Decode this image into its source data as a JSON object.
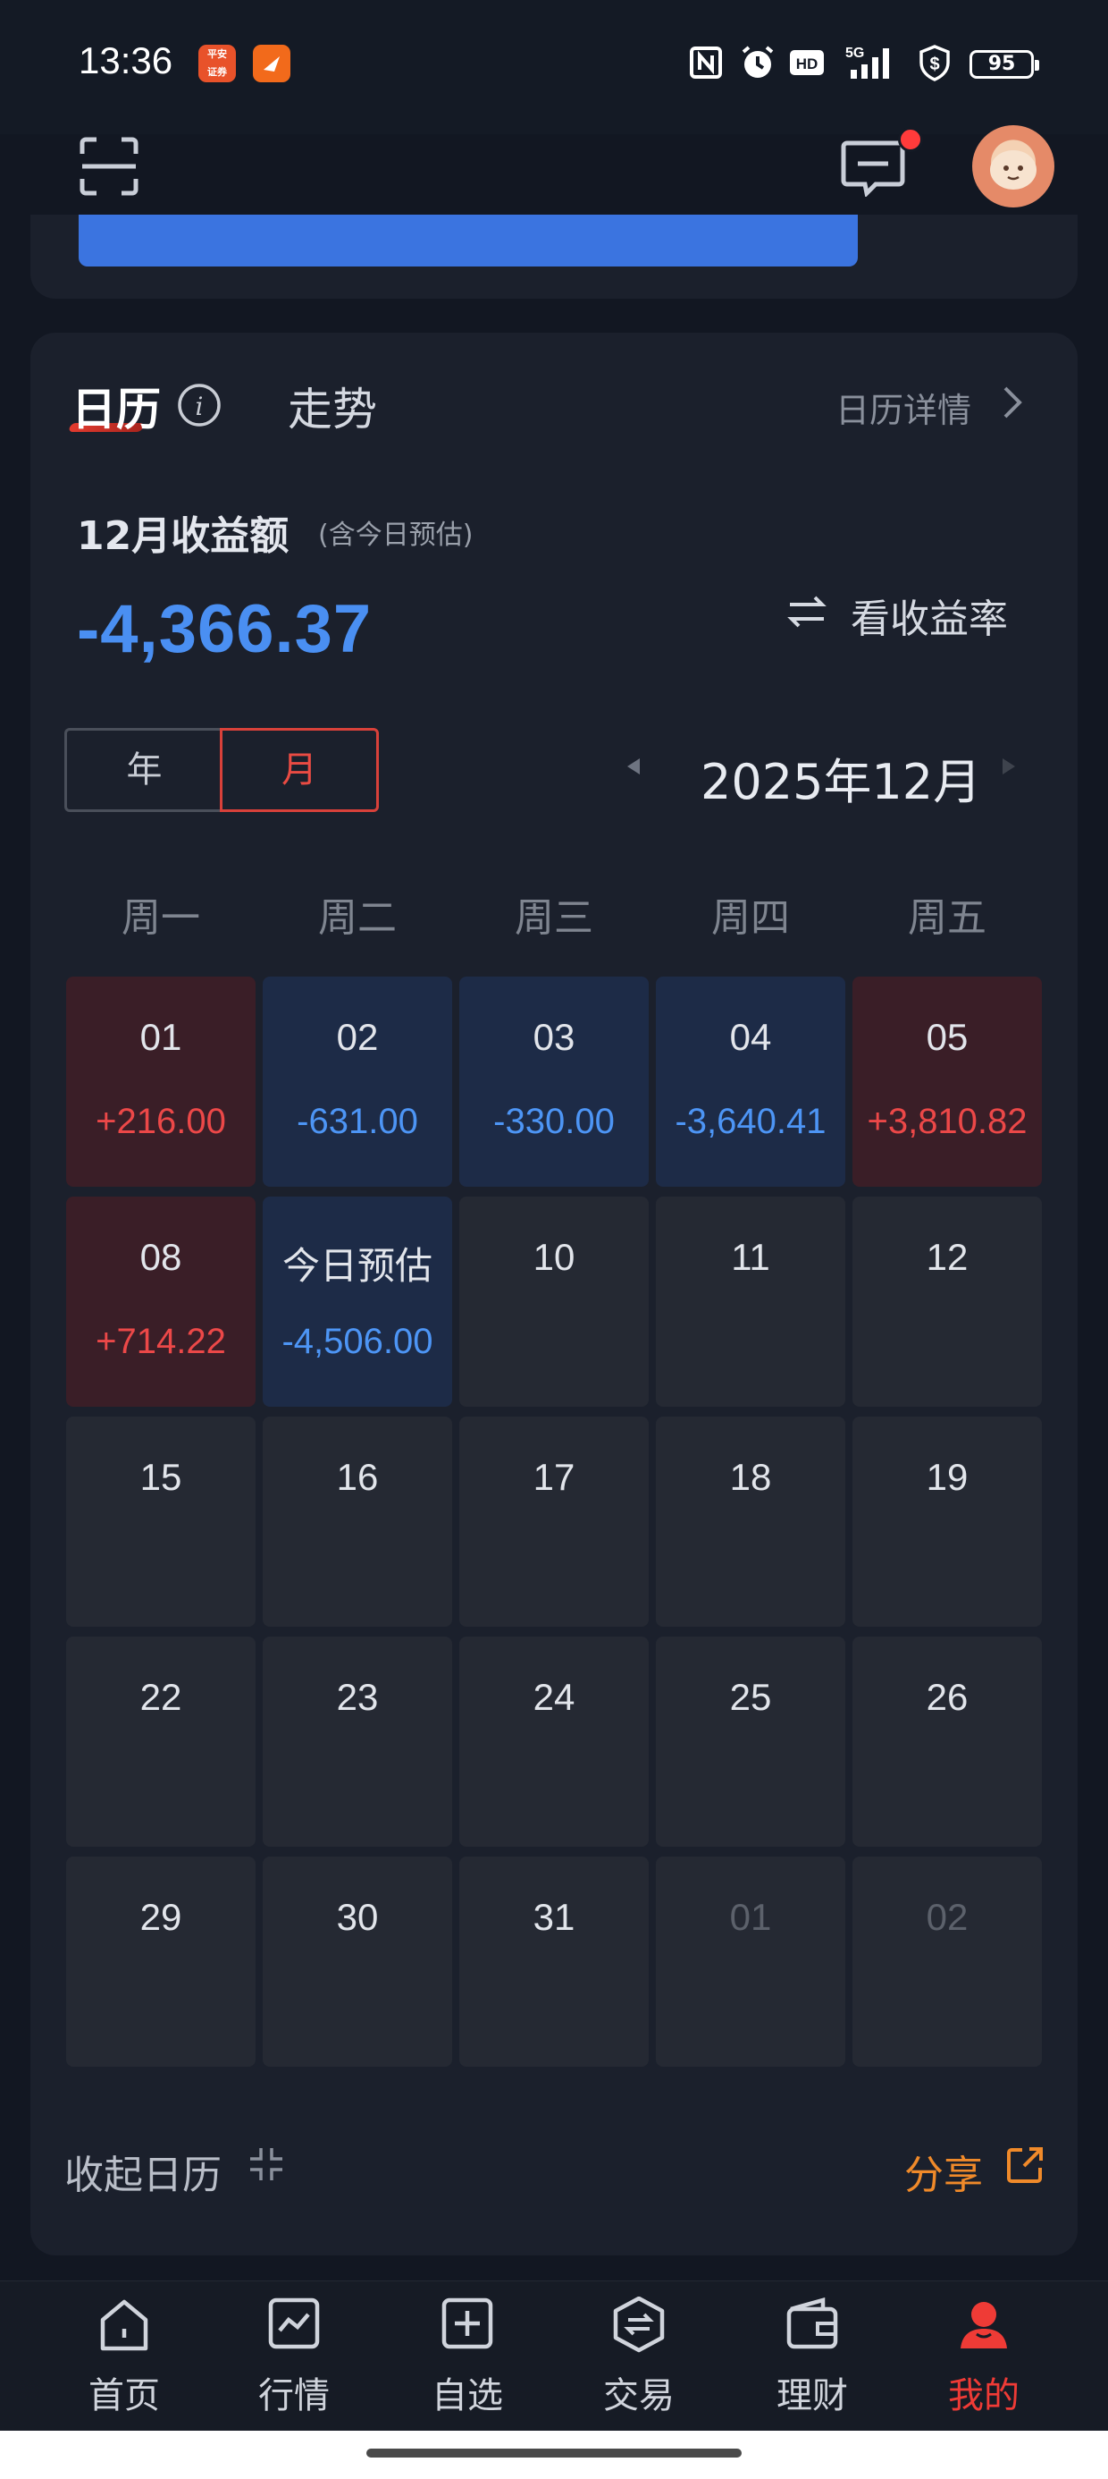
{
  "status_bar": {
    "time": "13:36",
    "app_badge_1": "平安证券",
    "network": "5G",
    "hd": "HD",
    "battery": "95"
  },
  "header": {
    "scan_icon": "scan-icon",
    "message_icon": "message-icon",
    "avatar": "avatar"
  },
  "card": {
    "tabs": {
      "calendar": "日历",
      "trend": "走势"
    },
    "detail_link": "日历详情",
    "income_title": "12月收益额",
    "income_note": "(含今日预估)",
    "income_amount": "-4,366.37",
    "view_rate": "看收益率",
    "segments": {
      "year": "年",
      "month": "月",
      "selected": "月"
    },
    "month_label": "2025年12月",
    "weekdays": [
      "周一",
      "周二",
      "周三",
      "周四",
      "周五"
    ],
    "colors": {
      "gain": "#ec4848",
      "loss": "#4d95f5",
      "accent": "#f08a2a",
      "active_tab": "#ef3b36"
    },
    "weeks": [
      [
        {
          "day": "01",
          "value": "+216.00",
          "state": "pos"
        },
        {
          "day": "02",
          "value": "-631.00",
          "state": "neg"
        },
        {
          "day": "03",
          "value": "-330.00",
          "state": "neg"
        },
        {
          "day": "04",
          "value": "-3,640.41",
          "state": "neg"
        },
        {
          "day": "05",
          "value": "+3,810.82",
          "state": "pos"
        }
      ],
      [
        {
          "day": "08",
          "value": "+714.22",
          "state": "pos"
        },
        {
          "day": "今日预估",
          "value": "-4,506.00",
          "state": "neg"
        },
        {
          "day": "10",
          "value": "",
          "state": ""
        },
        {
          "day": "11",
          "value": "",
          "state": ""
        },
        {
          "day": "12",
          "value": "",
          "state": ""
        }
      ],
      [
        {
          "day": "15",
          "value": "",
          "state": ""
        },
        {
          "day": "16",
          "value": "",
          "state": ""
        },
        {
          "day": "17",
          "value": "",
          "state": ""
        },
        {
          "day": "18",
          "value": "",
          "state": ""
        },
        {
          "day": "19",
          "value": "",
          "state": ""
        }
      ],
      [
        {
          "day": "22",
          "value": "",
          "state": ""
        },
        {
          "day": "23",
          "value": "",
          "state": ""
        },
        {
          "day": "24",
          "value": "",
          "state": ""
        },
        {
          "day": "25",
          "value": "",
          "state": ""
        },
        {
          "day": "26",
          "value": "",
          "state": ""
        }
      ],
      [
        {
          "day": "29",
          "value": "",
          "state": ""
        },
        {
          "day": "30",
          "value": "",
          "state": ""
        },
        {
          "day": "31",
          "value": "",
          "state": ""
        },
        {
          "day": "01",
          "value": "",
          "state": "dim"
        },
        {
          "day": "02",
          "value": "",
          "state": "dim"
        }
      ]
    ],
    "collapse": "收起日历",
    "share": "分享"
  },
  "bottom_nav": [
    {
      "label": "首页",
      "icon": "home-icon"
    },
    {
      "label": "行情",
      "icon": "market-chart-icon"
    },
    {
      "label": "自选",
      "icon": "add-watchlist-icon"
    },
    {
      "label": "交易",
      "icon": "trade-exchange-icon"
    },
    {
      "label": "理财",
      "icon": "wallet-icon"
    },
    {
      "label": "我的",
      "icon": "profile-icon",
      "active": true
    }
  ]
}
